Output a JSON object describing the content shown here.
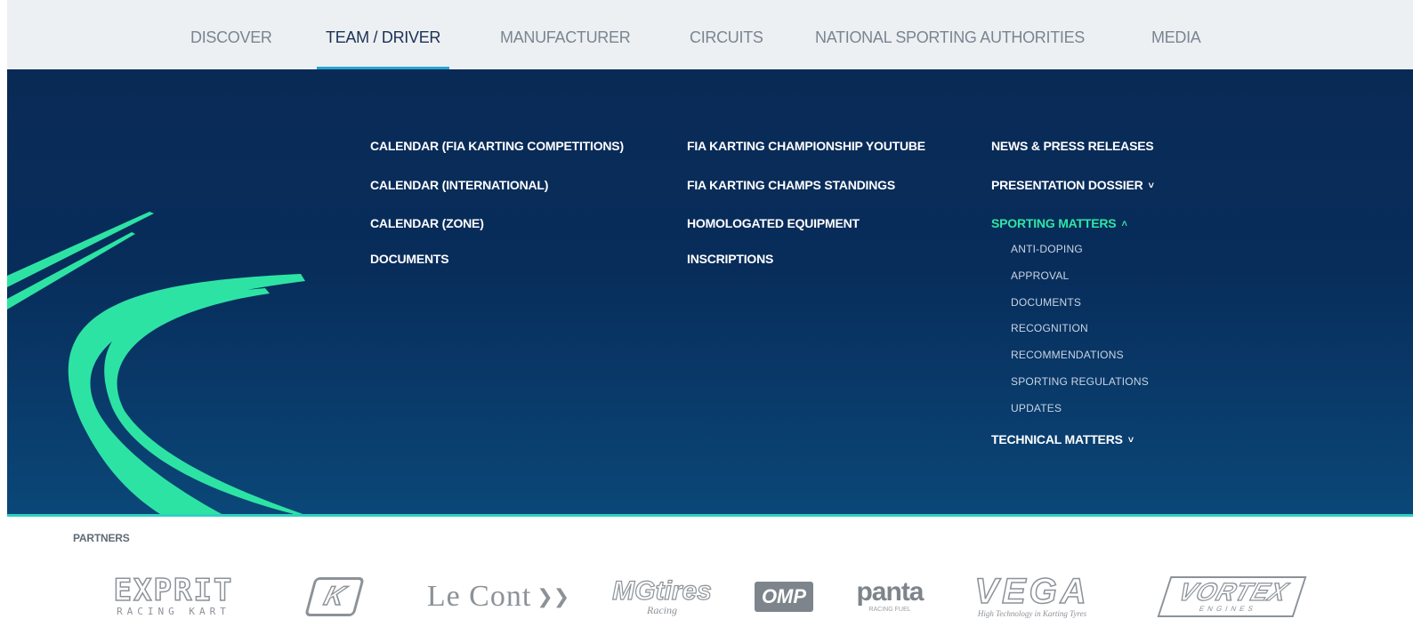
{
  "topnav": {
    "tabs": [
      {
        "label": "DISCOVER"
      },
      {
        "label": "TEAM / DRIVER",
        "active": true
      },
      {
        "label": "MANUFACTURER"
      },
      {
        "label": "CIRCUITS"
      },
      {
        "label": "NATIONAL SPORTING AUTHORITIES"
      },
      {
        "label": "MEDIA"
      }
    ]
  },
  "menu": {
    "col1": [
      {
        "label": "CALENDAR (FIA KARTING COMPETITIONS)"
      },
      {
        "label": "CALENDAR (INTERNATIONAL)"
      },
      {
        "label": "CALENDAR (ZONE)"
      },
      {
        "label": "DOCUMENTS"
      }
    ],
    "col2": [
      {
        "label": "FIA KARTING CHAMPIONSHIP YOUTUBE"
      },
      {
        "label": "FIA KARTING CHAMPS STANDINGS"
      },
      {
        "label": "HOMOLOGATED EQUIPMENT"
      },
      {
        "label": "INSCRIPTIONS"
      }
    ],
    "col3": {
      "news": "NEWS & PRESS RELEASES",
      "presentation": "PRESENTATION DOSSIER",
      "sporting": "SPORTING MATTERS",
      "sporting_items": [
        {
          "label": "ANTI-DOPING"
        },
        {
          "label": "APPROVAL"
        },
        {
          "label": "DOCUMENTS"
        },
        {
          "label": "RECOGNITION"
        },
        {
          "label": "RECOMMENDATIONS"
        },
        {
          "label": "SPORTING REGULATIONS"
        },
        {
          "label": "UPDATES"
        }
      ],
      "technical": "TECHNICAL MATTERS",
      "chevron_down": "⌵",
      "chevron_up": "⌃"
    }
  },
  "colors": {
    "accent_green": "#2ee6a5",
    "active_underline": "#23a7d1",
    "menu_bg": "#0a2a56"
  },
  "partners": {
    "title": "PARTNERS",
    "logos": [
      {
        "name": "EXPRIT",
        "sub": "RACING KART"
      },
      {
        "name": "K"
      },
      {
        "name": "Le Cont"
      },
      {
        "name": "MGtires",
        "sub": "Racing"
      },
      {
        "name": "OMP"
      },
      {
        "name": "panta",
        "sub": "RACING FUEL"
      },
      {
        "name": "VEGA",
        "sub": "High Technology in Karting Tyres"
      },
      {
        "name": "VORTEX",
        "sub": "ENGINES"
      }
    ]
  }
}
